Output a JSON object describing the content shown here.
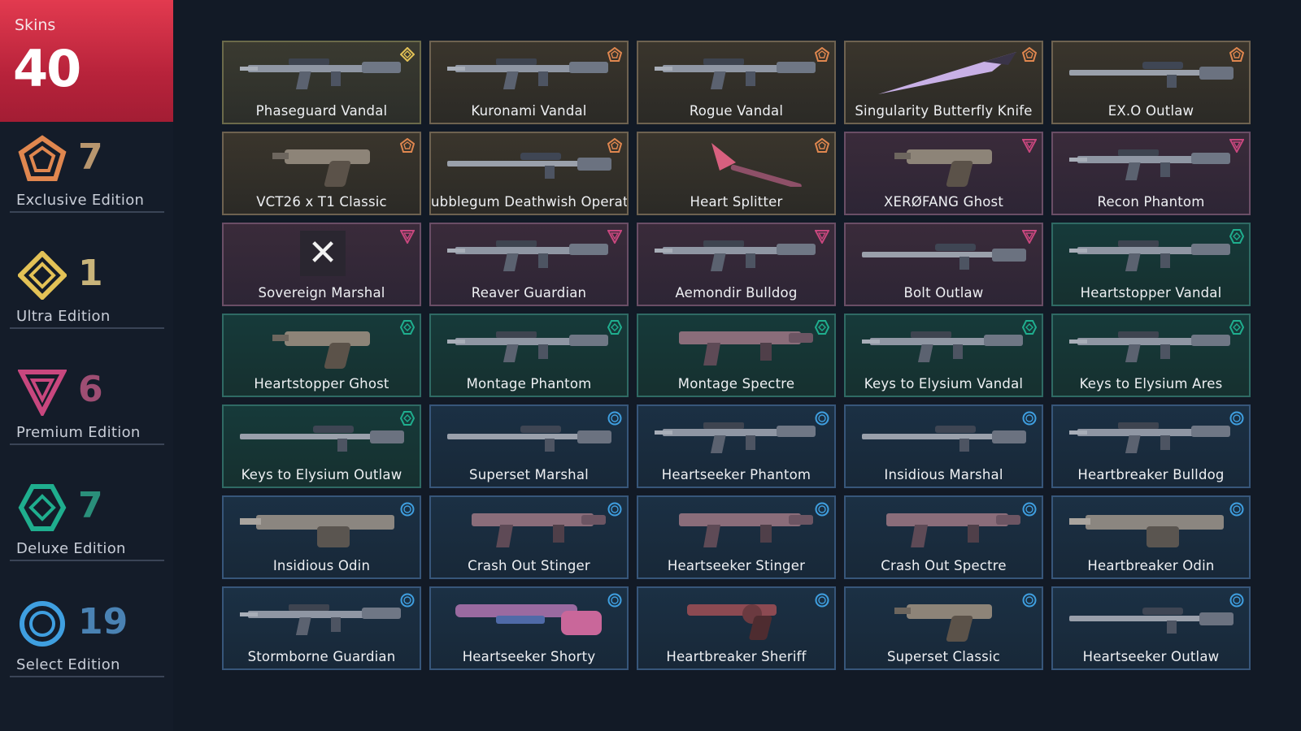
{
  "sidebar": {
    "skins_label": "Skins",
    "skins_count": "40",
    "tiers": [
      {
        "key": "exclusive",
        "count": "7",
        "name": "Exclusive Edition",
        "color": "#e0874f"
      },
      {
        "key": "ultra",
        "count": "1",
        "name": "Ultra Edition",
        "color": "#e3c256"
      },
      {
        "key": "premium",
        "count": "6",
        "name": "Premium Edition",
        "color": "#c8477e"
      },
      {
        "key": "deluxe",
        "count": "7",
        "name": "Deluxe Edition",
        "color": "#1fae8e"
      },
      {
        "key": "select",
        "count": "19",
        "name": "Select Edition",
        "color": "#3f9fe0"
      }
    ]
  },
  "colors": {
    "exclusive": "#e0874f",
    "ultra": "#e3c256",
    "premium": "#c8477e",
    "deluxe": "#1fae8e",
    "select": "#3f9fe0"
  },
  "skins": [
    {
      "name": "Phaseguard Vandal",
      "tier": "ultra",
      "art": "rifle"
    },
    {
      "name": "Kuronami Vandal",
      "tier": "exclusive",
      "art": "rifle"
    },
    {
      "name": "Rogue Vandal",
      "tier": "exclusive",
      "art": "rifle"
    },
    {
      "name": "Singularity Butterfly Knife",
      "tier": "exclusive",
      "art": "knife"
    },
    {
      "name": "EX.O Outlaw",
      "tier": "exclusive",
      "art": "sniper"
    },
    {
      "name": "VCT26 x T1 Classic",
      "tier": "exclusive",
      "art": "pistol"
    },
    {
      "name": "ubblegum Deathwish Operato",
      "tier": "exclusive",
      "art": "sniper"
    },
    {
      "name": "Heart Splitter",
      "tier": "exclusive",
      "art": "melee"
    },
    {
      "name": "XERØFANG Ghost",
      "tier": "premium",
      "art": "pistol"
    },
    {
      "name": "Recon Phantom",
      "tier": "premium",
      "art": "rifle"
    },
    {
      "name": "Sovereign Marshal",
      "tier": "premium",
      "art": "x"
    },
    {
      "name": "Reaver Guardian",
      "tier": "premium",
      "art": "rifle"
    },
    {
      "name": "Aemondir Bulldog",
      "tier": "premium",
      "art": "rifle"
    },
    {
      "name": "Bolt Outlaw",
      "tier": "premium",
      "art": "sniper"
    },
    {
      "name": "Heartstopper Vandal",
      "tier": "deluxe",
      "art": "rifle"
    },
    {
      "name": "Heartstopper Ghost",
      "tier": "deluxe",
      "art": "pistol"
    },
    {
      "name": "Montage Phantom",
      "tier": "deluxe",
      "art": "rifle"
    },
    {
      "name": "Montage Spectre",
      "tier": "deluxe",
      "art": "smg"
    },
    {
      "name": "Keys to Elysium Vandal",
      "tier": "deluxe",
      "art": "rifle"
    },
    {
      "name": "Keys to Elysium Ares",
      "tier": "deluxe",
      "art": "rifle"
    },
    {
      "name": "Keys to Elysium Outlaw",
      "tier": "deluxe",
      "art": "sniper"
    },
    {
      "name": "Superset Marshal",
      "tier": "select",
      "art": "sniper"
    },
    {
      "name": "Heartseeker Phantom",
      "tier": "select",
      "art": "rifle"
    },
    {
      "name": "Insidious Marshal",
      "tier": "select",
      "art": "sniper"
    },
    {
      "name": "Heartbreaker Bulldog",
      "tier": "select",
      "art": "rifle"
    },
    {
      "name": "Insidious Odin",
      "tier": "select",
      "art": "heavy"
    },
    {
      "name": "Crash Out Stinger",
      "tier": "select",
      "art": "smg"
    },
    {
      "name": "Heartseeker Stinger",
      "tier": "select",
      "art": "smg"
    },
    {
      "name": "Crash Out Spectre",
      "tier": "select",
      "art": "smg"
    },
    {
      "name": "Heartbreaker Odin",
      "tier": "select",
      "art": "heavy"
    },
    {
      "name": "Stormborne Guardian",
      "tier": "select",
      "art": "rifle"
    },
    {
      "name": "Heartseeker Shorty",
      "tier": "select",
      "art": "shotgun"
    },
    {
      "name": "Heartbreaker Sheriff",
      "tier": "select",
      "art": "revolver"
    },
    {
      "name": "Superset Classic",
      "tier": "select",
      "art": "pistol"
    },
    {
      "name": "Heartseeker Outlaw",
      "tier": "select",
      "art": "sniper"
    }
  ]
}
